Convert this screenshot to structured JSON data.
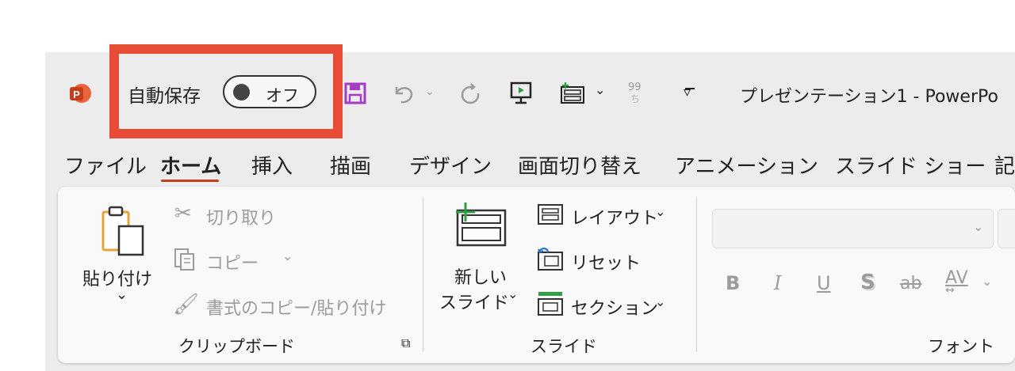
{
  "titlebar": {
    "autosave_label": "自動保存",
    "autosave_state": "オフ",
    "title": "プレゼンテーション1  -  PowerPo"
  },
  "tabs": [
    {
      "label": "ファイル"
    },
    {
      "label": "ホーム"
    },
    {
      "label": "挿入"
    },
    {
      "label": "描画"
    },
    {
      "label": "デザイン"
    },
    {
      "label": "画面切り替え"
    },
    {
      "label": "アニメーション"
    },
    {
      "label": "スライド ショー"
    },
    {
      "label": "記"
    }
  ],
  "clipboard": {
    "paste": "貼り付け",
    "cut": "切り取り",
    "copy": "コピー",
    "format_painter": "書式のコピー/貼り付け",
    "group_label": "クリップボード"
  },
  "slides": {
    "new_slide_line1": "新しい",
    "new_slide_line2": "スライド",
    "layout": "レイアウト",
    "reset": "リセット",
    "section": "セクション",
    "group_label": "スライド"
  },
  "font": {
    "bold": "B",
    "italic": "I",
    "underline": "U",
    "shadow": "S",
    "strikethrough": "ab",
    "spacing": "AV",
    "group_label": "フォント"
  },
  "colors": {
    "powerpoint": "#c43e1c",
    "highlight": "#e84c37",
    "save": "#a53cc4",
    "new_slide_accent": "#2f9e44"
  }
}
